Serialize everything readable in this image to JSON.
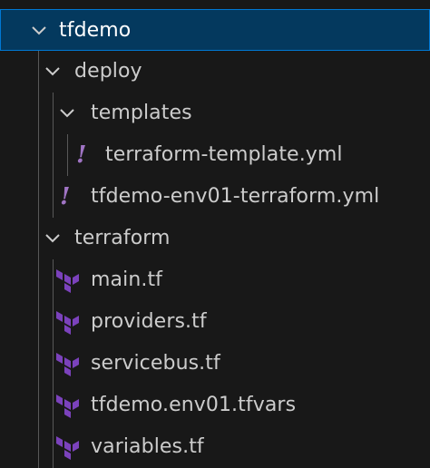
{
  "explorer": {
    "root": {
      "label": "tfdemo",
      "expanded": true,
      "selected": true,
      "icon": "chevron-down-icon"
    },
    "deploy": {
      "label": "deploy",
      "expanded": true,
      "icon": "chevron-down-icon"
    },
    "templates": {
      "label": "templates",
      "expanded": true,
      "icon": "chevron-down-icon"
    },
    "terraform_template_yml": {
      "label": "terraform-template.yml",
      "icon": "yaml-file-icon",
      "icon_glyph": "!"
    },
    "tfdemo_env01_yml": {
      "label": "tfdemo-env01-terraform.yml",
      "icon": "yaml-file-icon",
      "icon_glyph": "!"
    },
    "terraform": {
      "label": "terraform",
      "expanded": true,
      "icon": "chevron-down-icon"
    },
    "main_tf": {
      "label": "main.tf",
      "icon": "terraform-file-icon"
    },
    "providers_tf": {
      "label": "providers.tf",
      "icon": "terraform-file-icon"
    },
    "servicebus_tf": {
      "label": "servicebus.tf",
      "icon": "terraform-file-icon"
    },
    "tfvars": {
      "label": "tfdemo.env01.tfvars",
      "icon": "terraform-file-icon"
    },
    "variables_tf": {
      "label": "variables.tf",
      "icon": "terraform-file-icon"
    }
  },
  "colors": {
    "background": "#181818",
    "selection_background": "#04395e",
    "selection_border": "#0078d4",
    "text": "#cccccc",
    "yaml_icon": "#a074c4",
    "terraform_icon": "#7b42bc",
    "indent_guide": "#585858"
  }
}
